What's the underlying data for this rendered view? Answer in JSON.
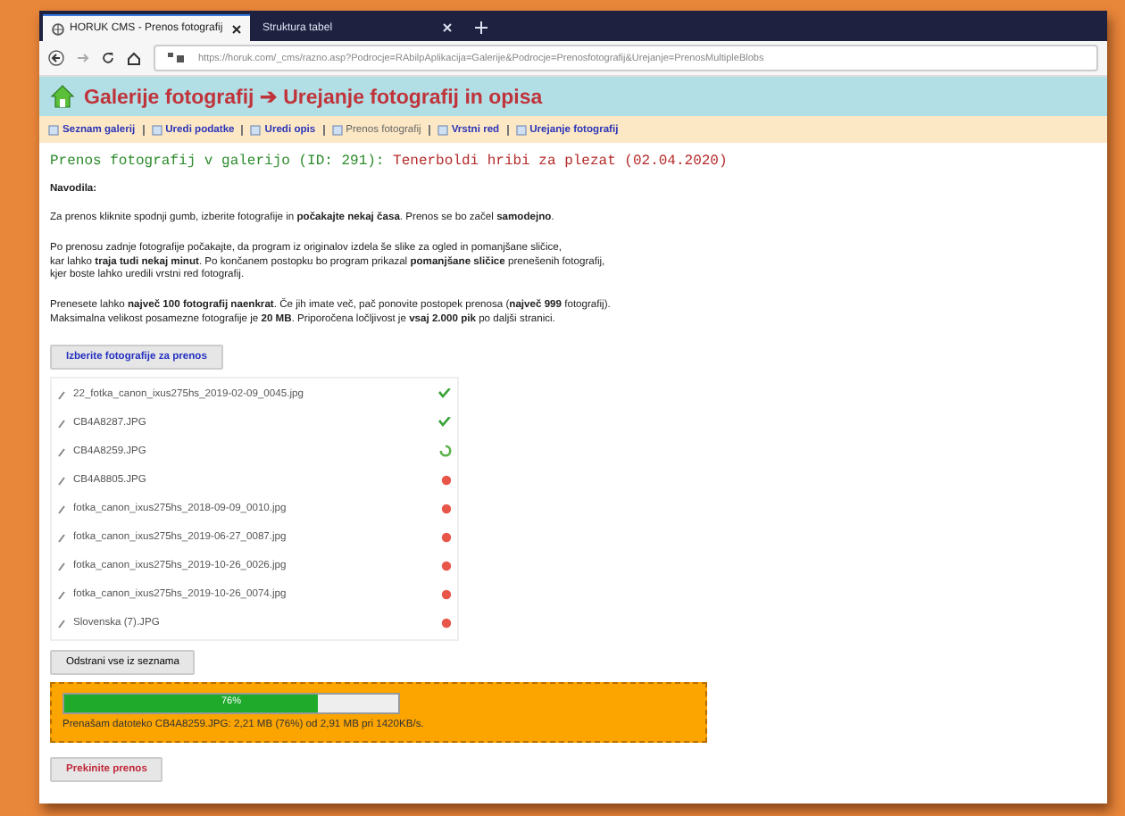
{
  "browser": {
    "tabs": [
      {
        "title": "HORUK CMS - Prenos fotografij",
        "selected": true
      },
      {
        "title": "Struktura tabel",
        "selected": false
      }
    ],
    "url": "https://horuk.com/_cms/razno.asp?Podrocje=RAbilpAplikacija=Galerije&Podrocje=Prenosfotografij&Urejanje=PrenosMultipleBlobs"
  },
  "header": {
    "title": "Galerije fotografij ➔ Urejanje fotografij in opisa"
  },
  "nav": [
    {
      "label": "Seznam galerij",
      "selected": false
    },
    {
      "label": "Uredi podatke",
      "selected": false
    },
    {
      "label": "Uredi opis",
      "selected": false
    },
    {
      "label": "Prenos fotografij",
      "selected": true
    },
    {
      "label": "Vrstni red",
      "selected": false
    },
    {
      "label": "Urejanje fotografij",
      "selected": false
    }
  ],
  "page_title": {
    "prefix": "Prenos fotografij v galerijo (ID: 291):",
    "gallery": "Tenerboldi hribi za plezat (02.04.2020)"
  },
  "instructions": {
    "heading": "Navodila:",
    "paragraphs": [
      "Za prenos kliknite spodnji gumb, izberite fotografije in **počakajte nekaj časa**. Prenos se bo začel **samodejno**.",
      "Po prenosu zadnje fotografije počakajte, da program iz originalov izdela še slike za ogled in pomanjšane sličice,\nkar lahko **traja tudi nekaj minut**. Po končanem postopku bo program prikazal **pomanjšane sličice** prenešenih fotografij,\nkjer boste lahko uredili vrstni red fotografij.",
      "Prenesete lahko **največ 100 fotografij naenkrat**. Če jih imate več, pač ponovite postopek prenosa (**največ 999** fotografij).\nMaksimalna velikost posamezne fotografije je **20 MB**. Priporočena ločljivost je **vsaj 2.000 pik** po daljši stranici."
    ]
  },
  "select_button": "Izberite fotografije za prenos",
  "files": [
    {
      "name": "22_fotka_canon_ixus275hs_2019-02-09_0045.jpg",
      "kind": "done"
    },
    {
      "name": "CB4A8287.JPG",
      "kind": "done"
    },
    {
      "name": "CB4A8259.JPG",
      "kind": "uploading"
    },
    {
      "name": "CB4A8805.JPG",
      "kind": "waiting"
    },
    {
      "name": "fotka_canon_ixus275hs_2018-09-09_0010.jpg",
      "kind": "waiting"
    },
    {
      "name": "fotka_canon_ixus275hs_2019-06-27_0087.jpg",
      "kind": "waiting"
    },
    {
      "name": "fotka_canon_ixus275hs_2019-10-26_0026.jpg",
      "kind": "waiting"
    },
    {
      "name": "fotka_canon_ixus275hs_2019-10-26_0074.jpg",
      "kind": "waiting"
    },
    {
      "name": "Slovenska (7).JPG",
      "kind": "waiting"
    }
  ],
  "clear_button": "Odstrani vse iz seznama",
  "progress": {
    "level": 0.76,
    "label": "76%",
    "message": "Prenašam datoteko CB4A8259.JPG: 2,21 MB (76%) od 2,91 MB pri 1420KB/s."
  },
  "cancel_button": "Prekinite prenos"
}
